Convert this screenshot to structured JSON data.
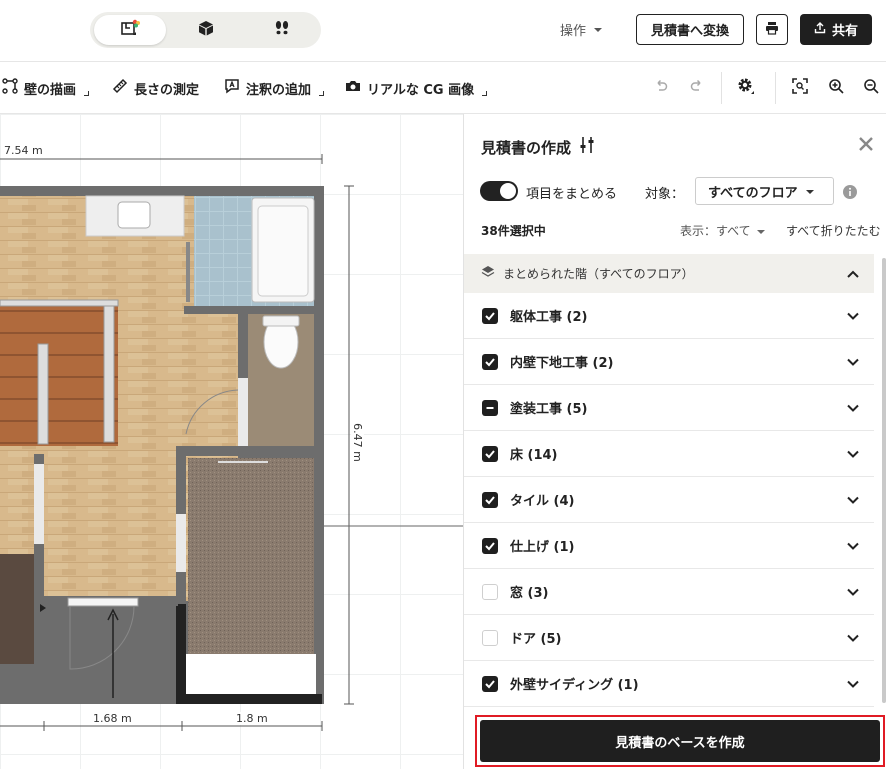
{
  "topbar": {
    "modes": [
      {
        "icon": "floorplan-2d-icon",
        "active": true
      },
      {
        "icon": "box-3d-icon",
        "active": false
      },
      {
        "icon": "footprints-icon",
        "active": false
      }
    ],
    "operations_label": "操作",
    "convert_button": "見積書へ変換",
    "print_icon": "print-icon",
    "share_button": "共有"
  },
  "toolbar": {
    "tools": [
      {
        "label": "壁の描画",
        "icon": "wall-draw-icon"
      },
      {
        "label": "長さの測定",
        "icon": "ruler-icon"
      },
      {
        "label": "注釈の追加",
        "icon": "annotation-icon"
      },
      {
        "label": "リアルな CG 画像",
        "icon": "camera-icon"
      }
    ],
    "undo_icon": "undo-icon",
    "redo_icon": "redo-icon",
    "settings_icon": "gear-icon",
    "fit_icon": "fit-screen-icon",
    "zoom_in_icon": "zoom-in-icon",
    "zoom_out_icon": "zoom-out-icon"
  },
  "canvas": {
    "dimensions": {
      "top": "7.54 m",
      "right": "6.47 m",
      "bottom_left": "1.68 m",
      "bottom_right": "1.8 m"
    }
  },
  "panel": {
    "title": "見積書の作成",
    "group_toggle_label": "項目をまとめる",
    "group_toggle_on": true,
    "target_label": "対象：",
    "target_value": "すべてのフロア",
    "selected_count": "38件選択中",
    "display_filter": "表示：すべて",
    "collapse_all": "すべて折りたたむ",
    "section_title": "まとめられた階（すべてのフロア）",
    "items": [
      {
        "label": "躯体工事 (2)",
        "state": "checked"
      },
      {
        "label": "内壁下地工事 (2)",
        "state": "checked"
      },
      {
        "label": "塗装工事 (5)",
        "state": "partial"
      },
      {
        "label": "床 (14)",
        "state": "checked"
      },
      {
        "label": "タイル (4)",
        "state": "checked"
      },
      {
        "label": "仕上げ (1)",
        "state": "checked"
      },
      {
        "label": "窓 (3)",
        "state": "unchecked"
      },
      {
        "label": "ドア (5)",
        "state": "unchecked"
      },
      {
        "label": "外壁サイディング (1)",
        "state": "checked"
      }
    ],
    "create_button": "見積書のベースを作成"
  }
}
